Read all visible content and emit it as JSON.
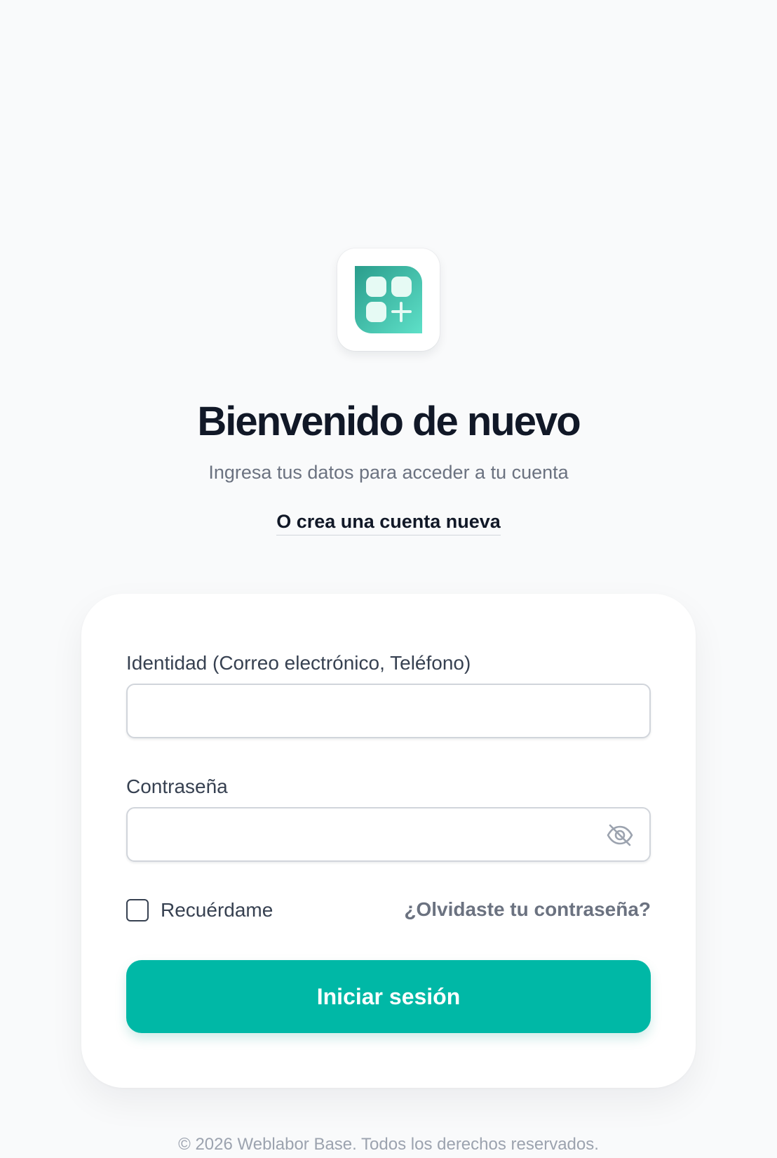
{
  "logo": {
    "icon": "apps-plus-icon",
    "gradient_from": "#2a9d8c",
    "gradient_to": "#5ee0c8"
  },
  "header": {
    "title": "Bienvenido de nuevo",
    "subtitle": "Ingresa tus datos para acceder a tu cuenta",
    "create_account_link": "O crea una cuenta nueva"
  },
  "form": {
    "identity": {
      "label": "Identidad (Correo electrónico, Teléfono)",
      "value": "",
      "placeholder": ""
    },
    "password": {
      "label": "Contraseña",
      "value": "",
      "placeholder": "",
      "toggle_icon": "eye-off-icon"
    },
    "remember_me": {
      "label": "Recuérdame",
      "checked": false
    },
    "forgot_password_link": "¿Olvidaste tu contraseña?",
    "submit_label": "Iniciar sesión"
  },
  "footer": {
    "copyright": "© 2026 Weblabor Base. Todos los derechos reservados."
  },
  "colors": {
    "accent": "#00b8a6",
    "background": "#f9fafb",
    "card": "#ffffff",
    "text_primary": "#111827",
    "text_secondary": "#6b7280"
  }
}
